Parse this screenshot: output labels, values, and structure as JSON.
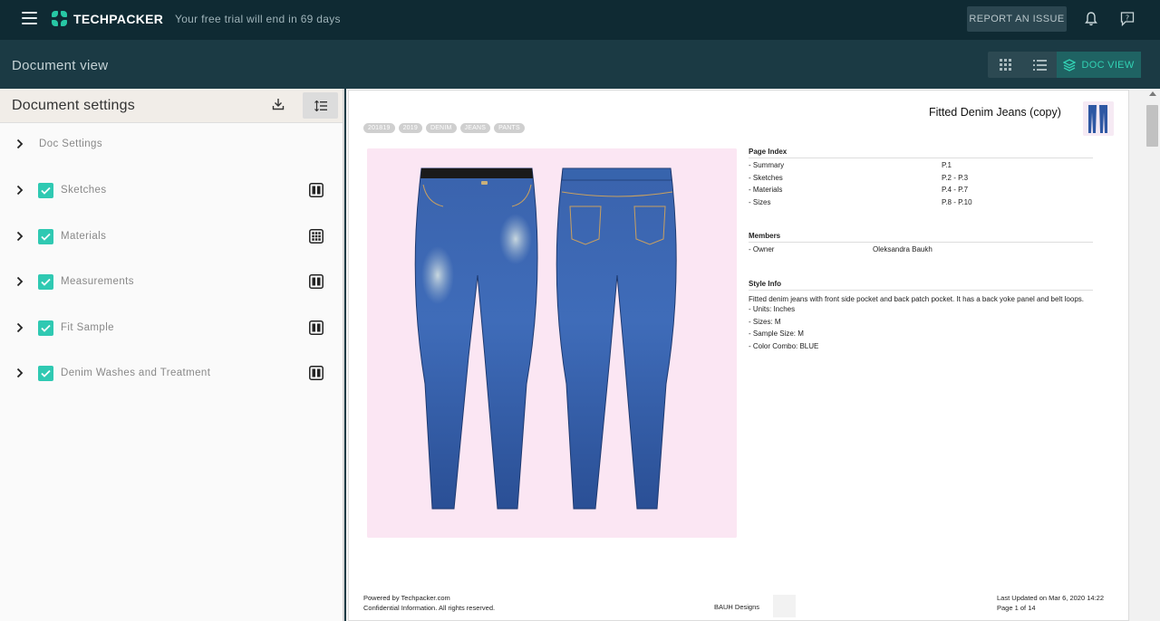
{
  "app": {
    "brand": "TECHPACKER",
    "trial_text": "Your free trial will end in 69 days",
    "report_label": "REPORT AN ISSUE",
    "accent_color": "#2fc9b2"
  },
  "subbar": {
    "page_title": "Document view",
    "doc_view_label": "DOC VIEW"
  },
  "settings": {
    "title": "Document settings",
    "items": [
      {
        "label": "Doc Settings",
        "checked": false,
        "layout_icon": "none"
      },
      {
        "label": "Sketches",
        "checked": true,
        "layout_icon": "two-column-icon"
      },
      {
        "label": "Materials",
        "checked": true,
        "layout_icon": "grid-layout-icon"
      },
      {
        "label": "Measurements",
        "checked": true,
        "layout_icon": "two-column-icon"
      },
      {
        "label": "Fit Sample",
        "checked": true,
        "layout_icon": "two-column-icon"
      },
      {
        "label": "Denim Washes and Treatment",
        "checked": true,
        "layout_icon": "two-column-icon"
      }
    ]
  },
  "document": {
    "title": "Fitted Denim Jeans (copy)",
    "tags": [
      "201819",
      "2019",
      "DENIM",
      "JEANS",
      "PANTS"
    ],
    "page_index": {
      "heading": "Page Index",
      "rows": [
        {
          "label": "- Summary",
          "page": "P.1"
        },
        {
          "label": "- Sketches",
          "page": "P.2 - P.3"
        },
        {
          "label": "- Materials",
          "page": "P.4 - P.7"
        },
        {
          "label": "- Sizes",
          "page": "P.8 - P.10"
        }
      ]
    },
    "members": {
      "heading": "Members",
      "rows": [
        {
          "label": "- Owner",
          "value": "Oleksandra Baukh"
        }
      ]
    },
    "style_info": {
      "heading": "Style Info",
      "description": "Fitted denim jeans with front side pocket and back patch pocket. It has a back yoke panel and belt loops.",
      "lines": [
        "- Units: Inches",
        "- Sizes: M",
        "- Sample Size: M",
        "- Color Combo: BLUE"
      ]
    },
    "footer": {
      "powered": "Powered by Techpacker.com",
      "confidential": "Confidential Information. All rights reserved.",
      "company": "BAUH Designs",
      "updated": "Last Updated on Mar 6, 2020 14:22",
      "page": "Page 1 of 14"
    }
  }
}
